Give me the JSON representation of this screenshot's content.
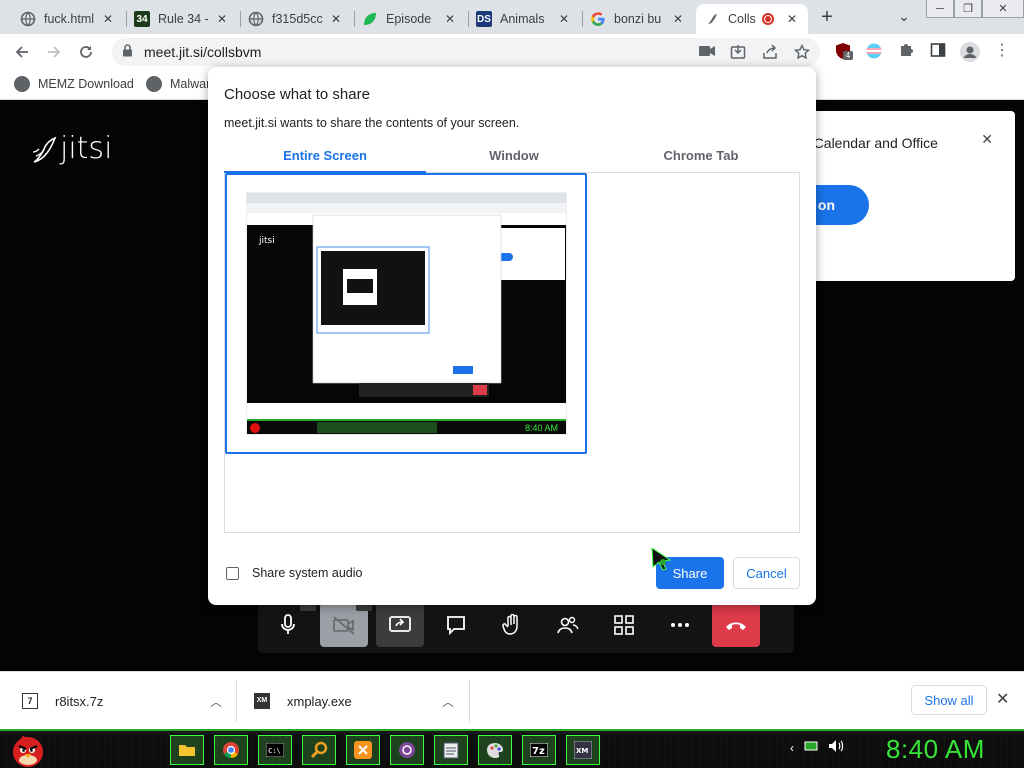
{
  "browser": {
    "tabs": [
      {
        "title": "fuck.html",
        "favicon": "globe-icon",
        "active": false
      },
      {
        "title": "Rule 34 -",
        "favicon": "rule34-icon",
        "active": false
      },
      {
        "title": "f315d5cc",
        "favicon": "globe-icon",
        "active": false
      },
      {
        "title": "Episode",
        "favicon": "leaf-icon",
        "active": false
      },
      {
        "title": "Animals",
        "favicon": "ds-icon",
        "active": false
      },
      {
        "title": "bonzi bu",
        "favicon": "google-icon",
        "active": false
      },
      {
        "title": "Colls",
        "favicon": "jitsi-icon",
        "active": true,
        "recording": true
      }
    ],
    "new_tab_symbol": "+",
    "url": "meet.jit.si/collsbvm",
    "bookmarks": [
      {
        "label": "MEMZ Download",
        "icon": "globe-icon"
      },
      {
        "label": "Malwar",
        "icon": "globe-icon"
      }
    ],
    "extension_badge": "4"
  },
  "jitsi": {
    "logo_text": "jitsi",
    "notice_text": "e Calendar and Office",
    "notice_button": "on"
  },
  "dialog": {
    "title": "Choose what to share",
    "subtitle": "meet.jit.si wants to share the contents of your screen.",
    "tabs": [
      {
        "label": "Entire Screen",
        "selected": true
      },
      {
        "label": "Window",
        "selected": false
      },
      {
        "label": "Chrome Tab",
        "selected": false
      }
    ],
    "audio_label": "Share system audio",
    "audio_checked": false,
    "share_label": "Share",
    "cancel_label": "Cancel"
  },
  "downloads": {
    "items": [
      {
        "name": "r8itsx.7z",
        "icon": "archive-icon"
      },
      {
        "name": "xmplay.exe",
        "icon": "xmplay-icon"
      }
    ],
    "show_all_label": "Show all"
  },
  "taskbar": {
    "clock": "8:40 AM",
    "apps": [
      "folder-icon",
      "chrome-icon",
      "cmd-icon",
      "search-icon",
      "scratch-icon",
      "tor-icon",
      "notepad-icon",
      "paint-icon",
      "7zip-icon",
      "xmplay-icon"
    ]
  },
  "colors": {
    "accent": "#1a73e8",
    "hangup": "#dd3b4a",
    "clock_green": "#36e536",
    "taskbar_green": "#3cff3c"
  }
}
